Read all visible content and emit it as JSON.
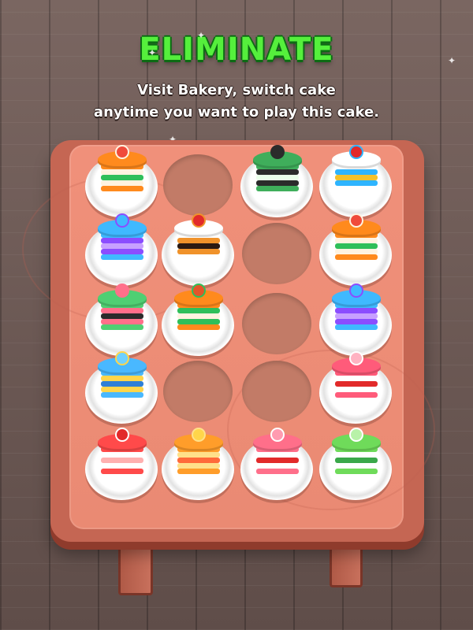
{
  "header": {
    "title": "ELIMINATE",
    "subtitle_line1": "Visit Bakery, switch cake",
    "subtitle_line2": "anytime you want to play this cake."
  },
  "colors": {
    "title": "#55ef3c",
    "title_outline": "#0d6b14",
    "table": "#ea8a73",
    "floor": "#6e5b56"
  },
  "board": {
    "rows": 5,
    "cols": 4,
    "cells": [
      {
        "row": 1,
        "col": 1,
        "state": "plate",
        "cake": "orange-tart",
        "colors": [
          "#ff8a1d",
          "#fff3e0",
          "#2fbf5a",
          "#f04b3b"
        ]
      },
      {
        "row": 1,
        "col": 2,
        "state": "empty"
      },
      {
        "row": 1,
        "col": 3,
        "state": "plate",
        "cake": "matcha-slice",
        "colors": [
          "#3fae5b",
          "#2b2b2b",
          "#eaffea",
          "#2b2b2b"
        ]
      },
      {
        "row": 1,
        "col": 4,
        "state": "plate",
        "cake": "cherry-slice",
        "colors": [
          "#ffffff",
          "#2eb4ff",
          "#f4c12a",
          "#e22a2a"
        ]
      },
      {
        "row": 2,
        "col": 1,
        "state": "plate",
        "cake": "blue-purple-slice",
        "colors": [
          "#3fb9ff",
          "#8b4dff",
          "#c7a0ff",
          "#3fb9ff"
        ]
      },
      {
        "row": 2,
        "col": 2,
        "state": "plate",
        "cake": "chocolate-cherry-slice",
        "colors": [
          "#ffffff",
          "#f0922a",
          "#2b1a12",
          "#e22a2a"
        ]
      },
      {
        "row": 2,
        "col": 3,
        "state": "empty"
      },
      {
        "row": 2,
        "col": 4,
        "state": "plate",
        "cake": "orange-tart",
        "colors": [
          "#ff8a1d",
          "#fff3e0",
          "#2fbf5a",
          "#f04b3b"
        ]
      },
      {
        "row": 3,
        "col": 1,
        "state": "plate",
        "cake": "green-pink-slice",
        "colors": [
          "#4fcf73",
          "#ff6f8a",
          "#2b2b2b",
          "#ff6f8a"
        ]
      },
      {
        "row": 3,
        "col": 2,
        "state": "plate",
        "cake": "orange-layer-slice",
        "colors": [
          "#ff8a1d",
          "#2fbf5a",
          "#fff3e0",
          "#e2552a"
        ]
      },
      {
        "row": 3,
        "col": 3,
        "state": "empty"
      },
      {
        "row": 3,
        "col": 4,
        "state": "plate",
        "cake": "blue-purple-slice",
        "colors": [
          "#3fb9ff",
          "#8b4dff",
          "#c7a0ff",
          "#3fb9ff"
        ]
      },
      {
        "row": 4,
        "col": 1,
        "state": "plate",
        "cake": "blue-banana-cake",
        "colors": [
          "#49b8ff",
          "#ffd54a",
          "#2e7fd6",
          "#6fd0ff"
        ]
      },
      {
        "row": 4,
        "col": 2,
        "state": "empty"
      },
      {
        "row": 4,
        "col": 3,
        "state": "empty"
      },
      {
        "row": 4,
        "col": 4,
        "state": "plate",
        "cake": "pink-cherry-stack",
        "colors": [
          "#ff5b7a",
          "#ffffff",
          "#e22a2a",
          "#ffb3c2"
        ]
      },
      {
        "row": 5,
        "col": 1,
        "state": "plate",
        "cake": "strawberry-cream-cake",
        "colors": [
          "#ff4a4a",
          "#ffffff",
          "#ffb0b0",
          "#e22a2a"
        ]
      },
      {
        "row": 5,
        "col": 2,
        "state": "plate",
        "cake": "small-orange-slice",
        "colors": [
          "#ff9d2a",
          "#ffe08a",
          "#ff6a3a",
          "#ffd54a"
        ]
      },
      {
        "row": 5,
        "col": 3,
        "state": "plate",
        "cake": "pink-square-cake",
        "colors": [
          "#ff6f8a",
          "#ffffff",
          "#e22a2a",
          "#ff9bb0"
        ]
      },
      {
        "row": 5,
        "col": 4,
        "state": "plate",
        "cake": "green-matcha-slice",
        "colors": [
          "#6fdb5a",
          "#ffffff",
          "#3aa84a",
          "#b8f2a8"
        ]
      }
    ]
  }
}
